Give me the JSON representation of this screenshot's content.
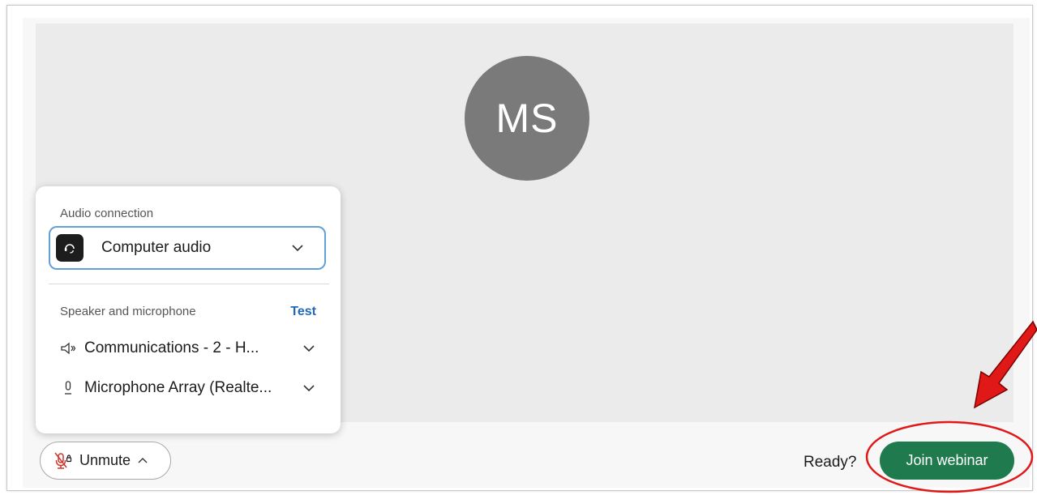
{
  "preview": {
    "avatar_initials": "MS"
  },
  "audio_panel": {
    "connection_label": "Audio connection",
    "connection_value": "Computer audio",
    "speaker_mic_label": "Speaker and microphone",
    "test_label": "Test",
    "speaker_value": "Communications - 2 - H...",
    "microphone_value": "Microphone Array (Realte..."
  },
  "footer": {
    "unmute_label": "Unmute",
    "ready_text": "Ready?",
    "join_label": "Join webinar"
  },
  "colors": {
    "join_button": "#1f7a4d",
    "test_link": "#1f69b6",
    "annotation": "#e01818",
    "avatar": "#7a7a7a"
  },
  "icons": {
    "connection": "headset-icon",
    "speaker": "speaker-icon",
    "microphone": "microphone-icon",
    "unmute": "muted-microphone-icon"
  }
}
